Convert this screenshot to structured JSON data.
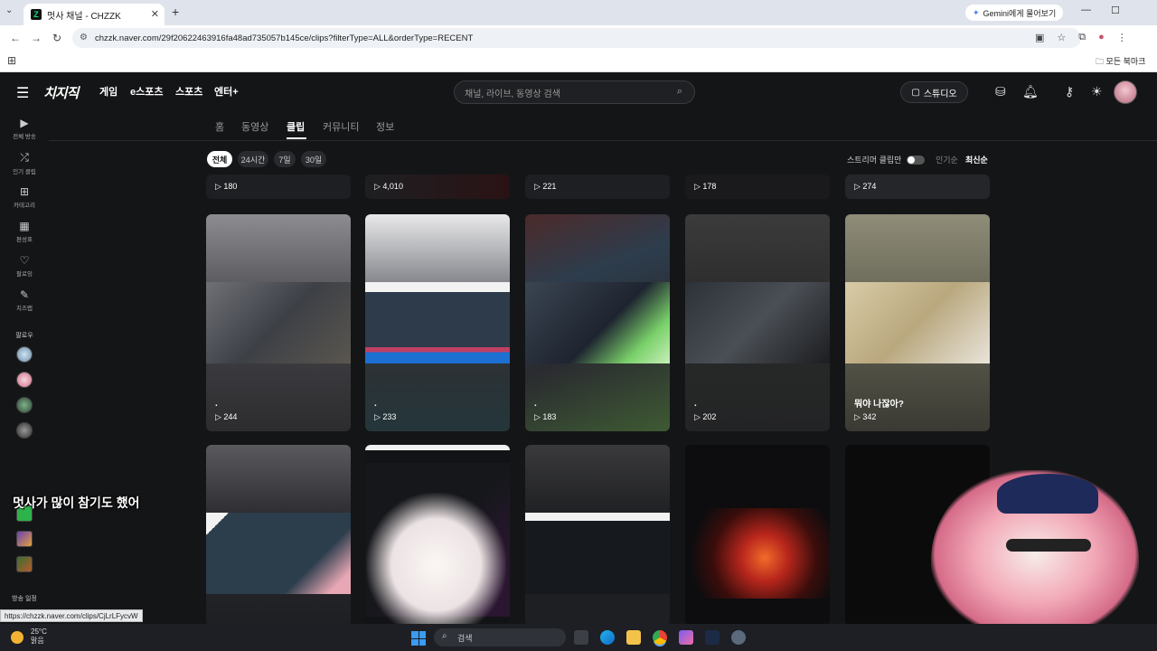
{
  "browser": {
    "tab_title": "멋사 채널 - CHZZK",
    "tab_favicon": "Z",
    "url": "chzzk.naver.com/29f20622463916fa48ad735057b145ce/clips?filterType=ALL&orderType=RECENT",
    "gemini_label": "Gemini에게 물어보기",
    "bookmarks_all": "모든 북마크",
    "status_url": "https://chzzk.naver.com/clips/CjLrLFycvW"
  },
  "header": {
    "logo": "치지직",
    "nav": [
      "게임",
      "e스포츠",
      "스포츠",
      "엔터+"
    ],
    "search_placeholder": "채널, 라이브, 동영상 검색",
    "studio_label": "스튜디오"
  },
  "sidebar": {
    "items": [
      {
        "icon": "live-icon",
        "label": "전체 방송"
      },
      {
        "icon": "shuffle-icon",
        "label": "인기 클립"
      },
      {
        "icon": "grid-icon",
        "label": "카테고리"
      },
      {
        "icon": "calendar-icon",
        "label": "편성표"
      },
      {
        "icon": "heart-icon",
        "label": "팔로잉"
      },
      {
        "icon": "pencil-icon",
        "label": "치즈랩"
      }
    ],
    "follow_label": "팔로우",
    "schedule_label": "방송 일정"
  },
  "channel_tabs": [
    {
      "label": "홈",
      "active": false
    },
    {
      "label": "동영상",
      "active": false
    },
    {
      "label": "클립",
      "active": true
    },
    {
      "label": "커뮤니티",
      "active": false
    },
    {
      "label": "정보",
      "active": false
    }
  ],
  "filters": {
    "chips": [
      {
        "label": "전체",
        "active": true
      },
      {
        "label": "24시간",
        "active": false
      },
      {
        "label": "7일",
        "active": false
      },
      {
        "label": "30일",
        "active": false
      }
    ],
    "streamer_clips_label": "스트리머 클립만",
    "streamer_clips_on": false,
    "sort_popular": "인기순",
    "sort_recent": "최신순"
  },
  "clip_rows": [
    {
      "views": [
        "180",
        "4,010",
        "221",
        "178",
        "274"
      ],
      "titles": [
        "",
        "",
        "",
        "",
        ""
      ]
    },
    {
      "views": [
        "244",
        "233",
        "183",
        "202",
        "342"
      ],
      "titles": [
        ".",
        ".",
        ".",
        ".",
        "뭐야 나잖아?"
      ]
    }
  ],
  "overlay": {
    "subtitle": "멋사가 많이 참기도 했어"
  },
  "taskbar": {
    "temp": "25°C",
    "weather": "맑음",
    "search_label": "검색"
  }
}
